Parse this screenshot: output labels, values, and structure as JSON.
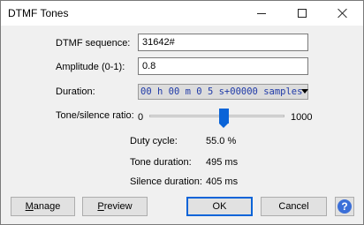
{
  "window": {
    "title": "DTMF Tones"
  },
  "form": {
    "sequence_label": "DTMF sequence:",
    "sequence_value": "31642#",
    "amplitude_label": "Amplitude (0-1):",
    "amplitude_value": "0.8",
    "duration_label": "Duration:",
    "duration_display": {
      "hours": "00",
      "h": "h",
      "minutes": "00",
      "m": "m",
      "seconds_a": "0",
      "seconds_b": "5",
      "s": "s",
      "plus": "+",
      "samples": "00000",
      "samples_label": "samples"
    },
    "ratio_label": "Tone/silence ratio:",
    "ratio_min": "0",
    "ratio_max": "1000",
    "ratio_value_fraction": 0.55
  },
  "info": {
    "duty_cycle_label": "Duty cycle:",
    "duty_cycle_value": "55.0 %",
    "tone_duration_label": "Tone duration:",
    "tone_duration_value": "495 ms",
    "silence_duration_label": "Silence duration:",
    "silence_duration_value": "405 ms"
  },
  "buttons": {
    "manage": "anage",
    "manage_accel": "M",
    "preview": "review",
    "preview_accel": "P",
    "ok": "OK",
    "cancel": "Cancel",
    "help_icon": "?"
  },
  "colors": {
    "accent": "#0a64d8",
    "duration_text": "#1f3aa8"
  }
}
